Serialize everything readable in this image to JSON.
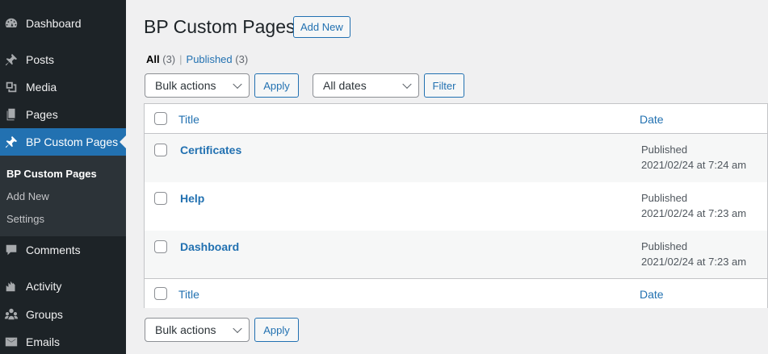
{
  "sidebar": {
    "items": [
      {
        "label": "Dashboard",
        "icon": "dashboard-icon"
      },
      {
        "label": "Posts",
        "icon": "pushpin-icon"
      },
      {
        "label": "Media",
        "icon": "media-icon"
      },
      {
        "label": "Pages",
        "icon": "pages-icon"
      },
      {
        "label": "BP Custom Pages",
        "icon": "pushpin-icon"
      },
      {
        "label": "Comments",
        "icon": "comment-icon"
      },
      {
        "label": "Activity",
        "icon": "activity-icon"
      },
      {
        "label": "Groups",
        "icon": "groups-icon"
      },
      {
        "label": "Emails",
        "icon": "email-icon"
      }
    ],
    "submenu": [
      "BP Custom Pages",
      "Add New",
      "Settings"
    ]
  },
  "header": {
    "title": "BP Custom Pages",
    "add_new_label": "Add New"
  },
  "filters": {
    "all_label": "All",
    "all_count": "(3)",
    "separator": "|",
    "published_label": "Published",
    "published_count": "(3)",
    "bulk_actions": "Bulk actions",
    "apply": "Apply",
    "all_dates": "All dates",
    "filter": "Filter"
  },
  "table": {
    "columns": {
      "title": "Title",
      "date": "Date"
    },
    "rows": [
      {
        "title": "Certificates",
        "status": "Published",
        "date": "2021/02/24 at 7:24 am"
      },
      {
        "title": "Help",
        "status": "Published",
        "date": "2021/02/24 at 7:23 am"
      },
      {
        "title": "Dashboard",
        "status": "Published",
        "date": "2021/02/24 at 7:23 am"
      }
    ]
  },
  "bottom": {
    "bulk_actions": "Bulk actions",
    "apply": "Apply"
  },
  "colors": {
    "sidebar_bg": "#1d2327",
    "submenu_bg": "#2c3338",
    "accent": "#2271b1",
    "page_bg": "#f0f0f1"
  }
}
